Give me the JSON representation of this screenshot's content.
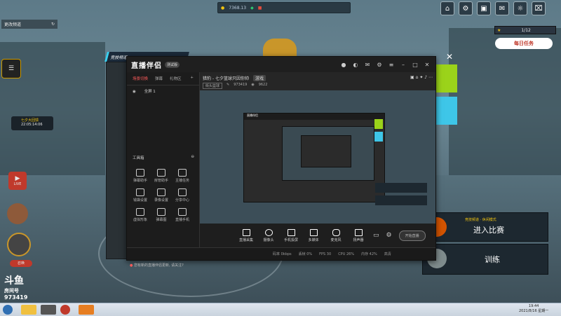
{
  "game": {
    "top_currency": "7368.13",
    "left_label": "更改频道",
    "timer_label": "七夕大回馈",
    "timer_value": "22:05:14:06",
    "live_badge": "LIVE",
    "level_text": "1/12",
    "task_label": "每日任务",
    "task_badge": "!",
    "enter_mode": "竞技频道 · 休闲模式",
    "enter_label": "进入比赛",
    "train_label": "训练",
    "close_symbol": "✕",
    "channel_tab": "竞技频道",
    "room_logo": "斗鱼",
    "room_label": "房间号",
    "room_number": "973419",
    "bottom_badge": "召唤"
  },
  "obs": {
    "logo": "直播伴侣",
    "version": "测试版",
    "tabs": [
      "场景切换",
      "弹幕",
      "礼物区"
    ],
    "scene_item": "全屏 1",
    "tools_title": "工具箱",
    "tools": [
      "弹幕助手",
      "房管助手",
      "主播任务",
      "钱袋设置",
      "录像设置",
      "分享中心",
      "虚拟形象",
      "弹幕图",
      "直播手机",
      "开播提示",
      "",
      ""
    ],
    "stream_title": "猎豹 - 七夕篮球只因你帅",
    "stream_tag": "游戏",
    "tag_chip": "街头篮球",
    "room_id": "973419",
    "viewers": "9622",
    "controls": [
      "直播采集",
      "摄像头",
      "手机投屏",
      "多媒体",
      "麦克风",
      "扬声器"
    ],
    "start_button": "开始直播",
    "notice": "您有新的直播伴侣更新, 请关注?",
    "status": [
      "码率 0kbps",
      "丢帧 0%",
      "FPS 30",
      "CPU 26%",
      "内存 42%",
      "推流 正常",
      "高清"
    ]
  },
  "taskbar": {
    "time": "19:44",
    "date": "2021/8/16 星期一"
  },
  "colors": {
    "accent_green": "#9bd31a",
    "accent_cyan": "#3ec6e8",
    "obs_red": "#ff5b5b"
  }
}
